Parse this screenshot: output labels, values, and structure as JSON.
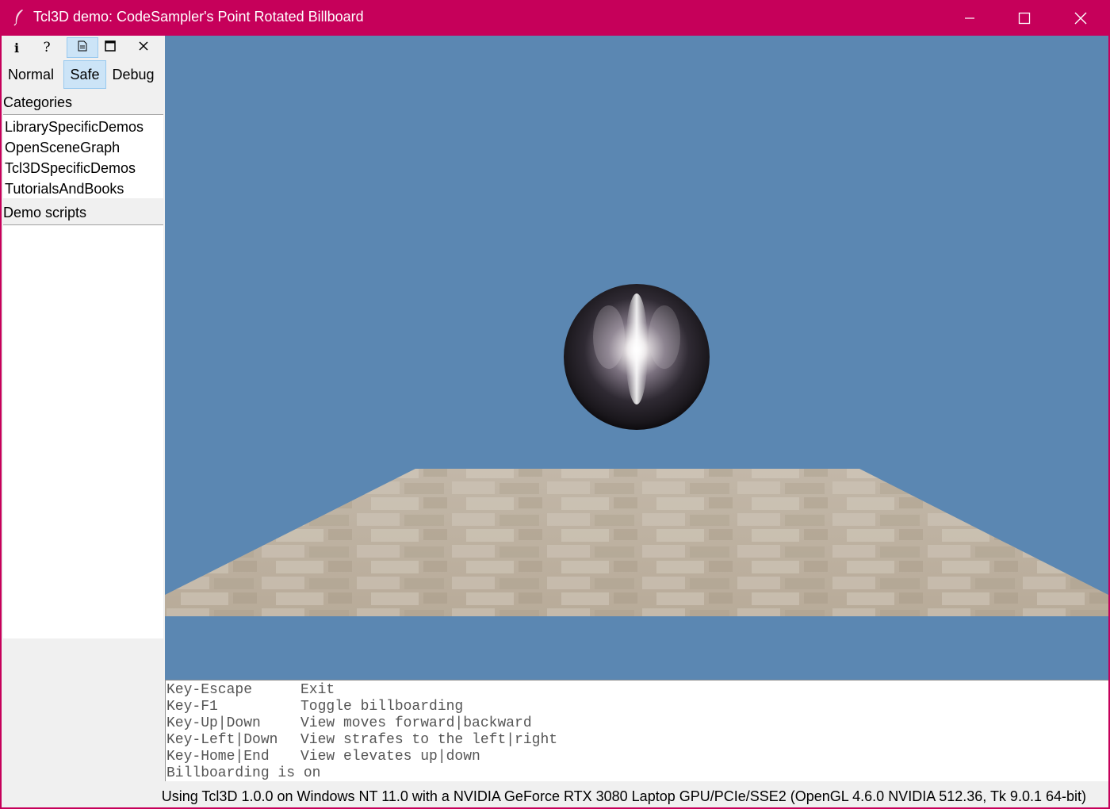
{
  "window": {
    "title": "Tcl3D demo: CodeSampler's Point Rotated Billboard"
  },
  "toolbar": {
    "buttons": [
      {
        "icon": "info-icon",
        "glyph": "i"
      },
      {
        "icon": "help-icon",
        "glyph": "?"
      },
      {
        "icon": "document-icon",
        "active": true
      },
      {
        "icon": "maximize-icon"
      },
      {
        "icon": "close-icon",
        "glyph": "✕"
      }
    ]
  },
  "modes": {
    "normal": "Normal",
    "safe": "Safe",
    "debug": "Debug",
    "selected": "Safe"
  },
  "sidebar": {
    "categories_label": "Categories",
    "categories": [
      "LibrarySpecificDemos",
      "OpenSceneGraph",
      "Tcl3DSpecificDemos",
      "TutorialsAndBooks"
    ],
    "demo_scripts_label": "Demo scripts",
    "demo_scripts": []
  },
  "scene": {
    "background_color": "#5b87b2",
    "objects": [
      "chrome-sphere",
      "stone-tile-floor"
    ]
  },
  "console": {
    "lines": [
      {
        "key": "Key-Escape",
        "desc": "Exit"
      },
      {
        "key": "Key-F1",
        "desc": "Toggle billboarding"
      },
      {
        "key": "Key-Up|Down",
        "desc": "View moves forward|backward"
      },
      {
        "key": "Key-Left|Down",
        "desc": "View strafes to the left|right"
      },
      {
        "key": "Key-Home|End",
        "desc": "View elevates up|down"
      },
      {
        "key": "Billboarding is on",
        "desc": ""
      }
    ]
  },
  "status": {
    "text": "Using Tcl3D 1.0.0 on Windows NT 11.0 with a NVIDIA GeForce RTX 3080 Laptop GPU/PCIe/SSE2 (OpenGL 4.6.0 NVIDIA 512.36, Tk 9.0.1 64-bit)"
  },
  "colors": {
    "titlebar": "#c6005a",
    "accent_selected": "#cce4f7",
    "panel": "#f0f0f0"
  }
}
